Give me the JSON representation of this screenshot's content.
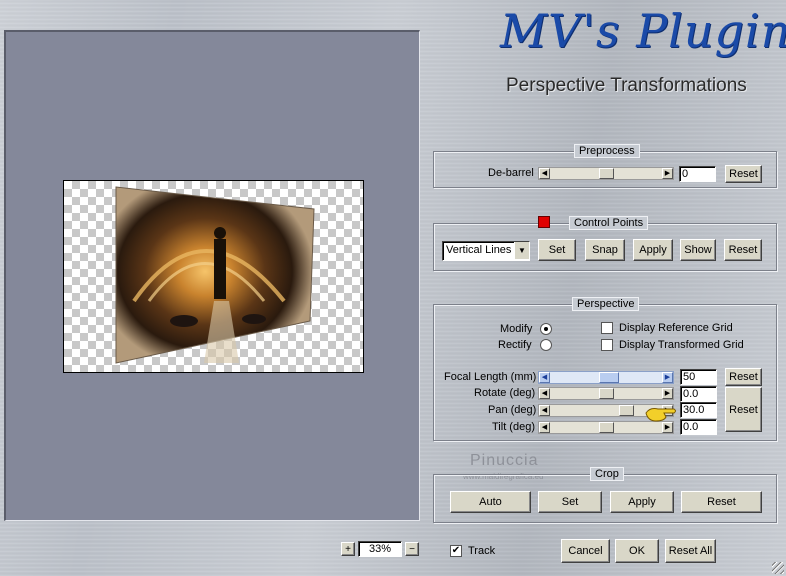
{
  "logo": {
    "script": "MV's Plugins",
    "title": "Perspective Transformations"
  },
  "preprocess": {
    "title": "Preprocess",
    "debarrel_label": "De-barrel",
    "debarrel_value": "0",
    "reset_label": "Reset"
  },
  "control_points": {
    "title": "Control Points",
    "marker_color": "#e00000",
    "dropdown_value": "Vertical Lines",
    "set_label": "Set",
    "snap_label": "Snap",
    "apply_label": "Apply",
    "show_label": "Show",
    "reset_label": "Reset"
  },
  "perspective": {
    "title": "Perspective",
    "modify_label": "Modify",
    "rectify_label": "Rectify",
    "display_reference_grid": "Display Reference Grid",
    "display_transformed_grid": "Display Transformed Grid",
    "focal_length_label": "Focal Length (mm)",
    "focal_length_value": "50",
    "rotate_label": "Rotate (deg)",
    "rotate_value": "0.0",
    "pan_label": "Pan (deg)",
    "pan_value": "30.0",
    "tilt_label": "Tilt (deg)",
    "tilt_value": "0.0",
    "reset_label": "Reset",
    "reset_all_label": "Reset"
  },
  "crop": {
    "title": "Crop",
    "auto_label": "Auto",
    "set_label": "Set",
    "apply_label": "Apply",
    "reset_label": "Reset"
  },
  "watermark": {
    "name": "Pinuccia",
    "url": "www.maidiregrafica.eu"
  },
  "footer": {
    "zoom_in": "+",
    "zoom_value": "33%",
    "zoom_out": "−",
    "track_label": "Track",
    "cancel_label": "Cancel",
    "ok_label": "OK",
    "reset_all_label": "Reset All"
  }
}
